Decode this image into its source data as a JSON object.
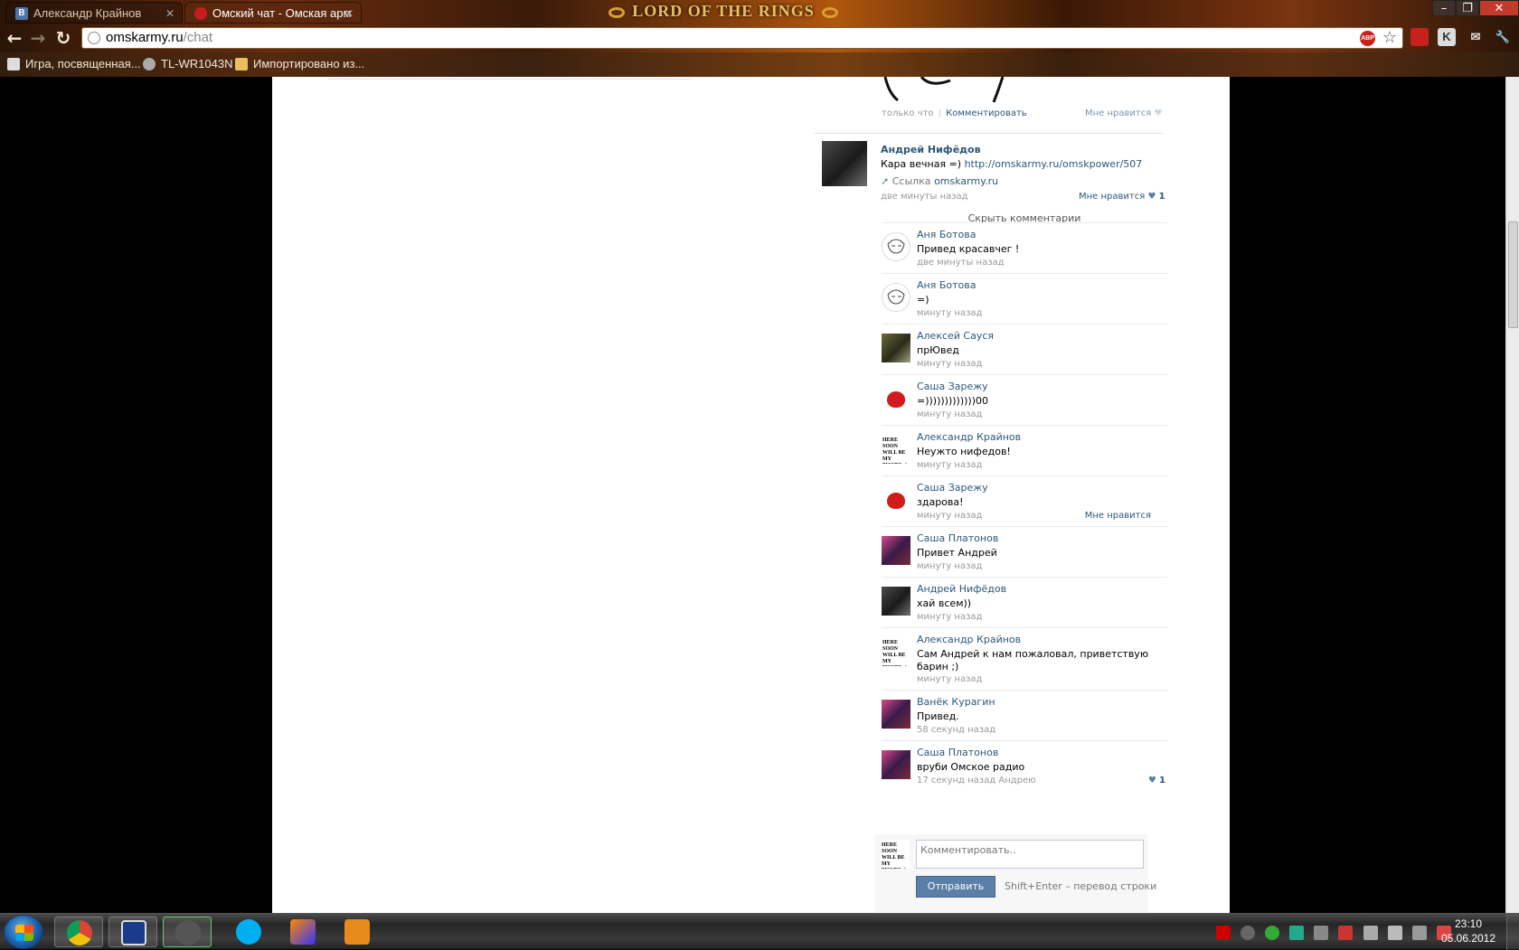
{
  "browser": {
    "tabs": [
      {
        "title": "Александр Крайнов",
        "favicon_letter": "В",
        "favicon_color": "#4a76a8"
      },
      {
        "title": "Омский чат - Омская арм",
        "favicon_color": "#c41e1e"
      }
    ],
    "theme_title": "LORD OF THE RINGS",
    "url_host": "omskarmy.ru",
    "url_path": "/chat",
    "abp_label": "ABP",
    "bookmarks": [
      "Игра, посвященная...",
      "TL-WR1043N",
      "Импортировано из..."
    ]
  },
  "post_top": {
    "time": "только что",
    "separator": "|",
    "comment_link": "Комментировать",
    "like_label": "Мне нравится"
  },
  "post": {
    "author": "Андрей Нифёдов",
    "text_prefix": "Кара вечная =) ",
    "link": "http://omskarmy.ru/omskpower/507",
    "attach_label": "Ссылка",
    "attach_host": "omskarmy.ru",
    "time": "две минуты назад",
    "like_label": "Мне нравится",
    "like_count": "1",
    "hide_comments": "Скрыть комментарии"
  },
  "comments": [
    {
      "name": "Аня Ботова",
      "text": "Привед красавчег !",
      "time": "две минуты назад",
      "avatar": "troll"
    },
    {
      "name": "Аня Ботова",
      "text": "=)",
      "time": "минуту назад",
      "avatar": "troll"
    },
    {
      "name": "Алексей Сауся",
      "text": "прЮвед",
      "time": "минуту назад",
      "avatar": "photo"
    },
    {
      "name": "Саша Зарежу",
      "text": "=)))))))))))))00",
      "time": "минуту назад",
      "avatar": "bird"
    },
    {
      "name": "Александр Крайнов",
      "text": "Неужто нифедов!",
      "time": "минуту назад",
      "avatar": "text"
    },
    {
      "name": "Саша Зарежу",
      "text": "здарова!",
      "time": "минуту назад",
      "avatar": "bird",
      "like": "Мне нравится"
    },
    {
      "name": "Саша Платонов",
      "text": "Привет Андрей",
      "time": "минуту назад",
      "avatar": "pink"
    },
    {
      "name": "Андрей Нифёдов",
      "text": "хай всем))",
      "time": "минуту назад",
      "avatar": "andrey"
    },
    {
      "name": "Александр Крайнов",
      "text": "Сам Андрей к нам пожаловал, приветствую барин ;)",
      "time": "минуту назад",
      "avatar": "text"
    },
    {
      "name": "Ванёк Курагин",
      "text": "Привед.",
      "time": "58 секунд назад",
      "avatar": "pink"
    },
    {
      "name": "Саша Платонов",
      "text": "вруби Омское радио",
      "time": "17 секунд назад Андрею",
      "avatar": "pink",
      "like_count": "1"
    }
  ],
  "avatar_text": "HERE SOON WILL BE MY PHOTO :) KRAYNOV.Z",
  "reply": {
    "placeholder": "Комментировать..",
    "send_label": "Отправить",
    "hint": "Shift+Enter – перевод строки"
  },
  "taskbar": {
    "time": "23:10",
    "date": "05.06.2012"
  }
}
